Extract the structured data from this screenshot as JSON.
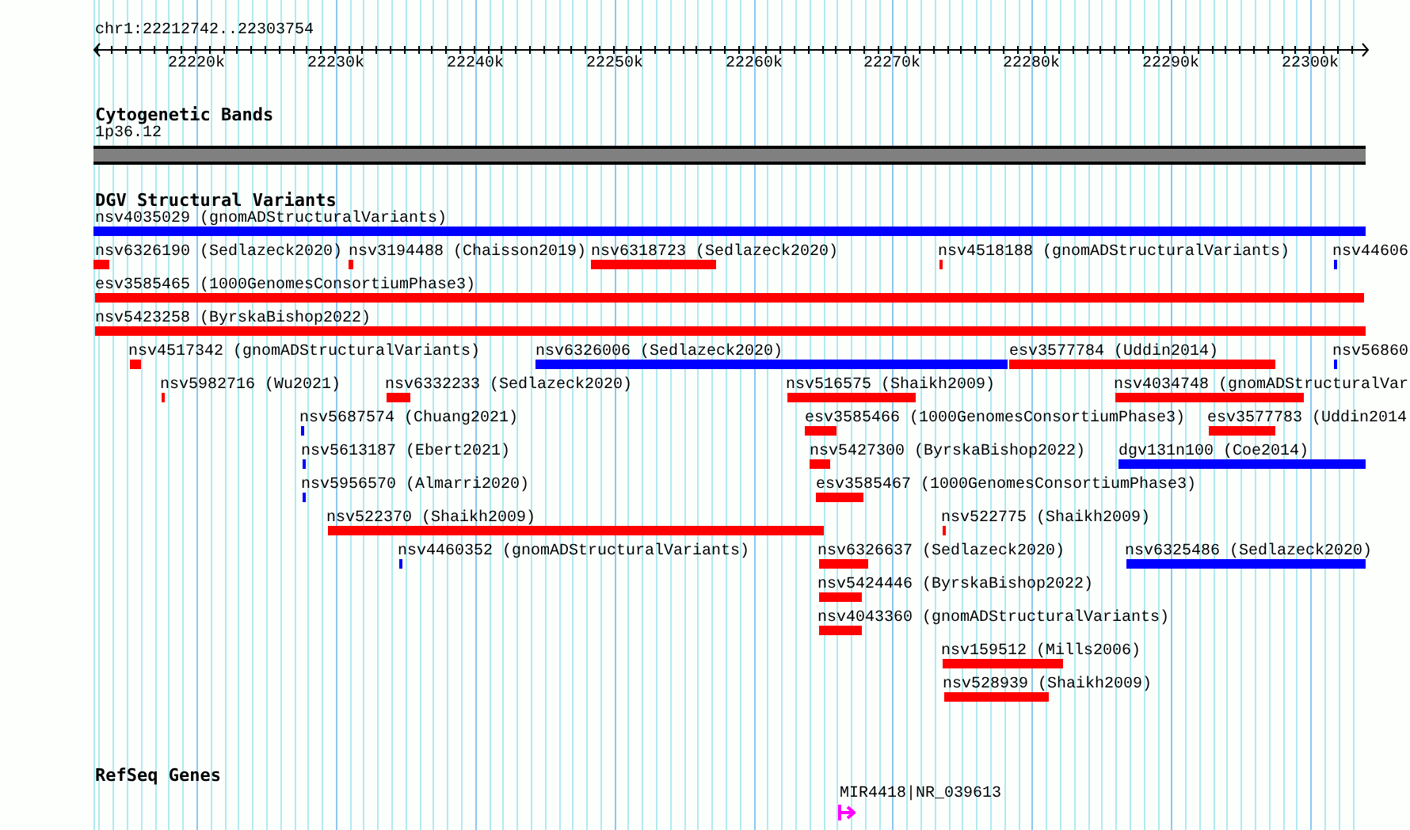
{
  "ruler": {
    "location": "chr1:22212742..22303754",
    "tick_labels": [
      "22220k",
      "22230k",
      "22240k",
      "22250k",
      "22260k",
      "22270k",
      "22280k",
      "22290k",
      "22300k"
    ]
  },
  "tracks": [
    {
      "kind": "cytoband",
      "title": "Cytogenetic Bands",
      "band": "1p36.12"
    },
    {
      "kind": "variants",
      "title": "DGV Structural Variants",
      "features": [
        {
          "label": "nsv4035029 (gnomADStructuralVariants)",
          "color": "#0000ff"
        },
        {
          "label": "nsv6326190 (Sedlazeck2020)",
          "color": "#ff0000"
        },
        {
          "label": "nsv3194488 (Chaisson2019)",
          "color": "#ff0000"
        },
        {
          "label": "nsv6318723 (Sedlazeck2020)",
          "color": "#ff0000"
        },
        {
          "label": "nsv4518188 (gnomADStructuralVariants)",
          "color": "#ff0000"
        },
        {
          "label": "nsv44606",
          "color": "#0000ff"
        },
        {
          "label": "esv3585465 (1000GenomesConsortiumPhase3)",
          "color": "#ff0000"
        },
        {
          "label": "nsv5423258 (ByrskaBishop2022)",
          "color": "#ff0000"
        },
        {
          "label": "nsv4517342 (gnomADStructuralVariants)",
          "color": "#ff0000"
        },
        {
          "label": "nsv6326006 (Sedlazeck2020)",
          "color": "#0000ff"
        },
        {
          "label": "esv3577784 (Uddin2014)",
          "color": "#ff0000"
        },
        {
          "label": "nsv56860",
          "color": "#0000ff"
        },
        {
          "label": "nsv5982716 (Wu2021)",
          "color": "#ff0000"
        },
        {
          "label": "nsv6332233 (Sedlazeck2020)",
          "color": "#ff0000"
        },
        {
          "label": "nsv516575 (Shaikh2009)",
          "color": "#ff0000"
        },
        {
          "label": "nsv4034748 (gnomADStructuralVar",
          "color": "#ff0000"
        },
        {
          "label": "nsv5687574 (Chuang2021)",
          "color": "#0000ff"
        },
        {
          "label": "esv3585466 (1000GenomesConsortiumPhase3)",
          "color": "#ff0000"
        },
        {
          "label": "esv3577783 (Uddin2014",
          "color": "#ff0000"
        },
        {
          "label": "nsv5613187 (Ebert2021)",
          "color": "#0000ff"
        },
        {
          "label": "nsv5427300 (ByrskaBishop2022)",
          "color": "#ff0000"
        },
        {
          "label": "dgv131n100 (Coe2014)",
          "color": "#0000ff"
        },
        {
          "label": "nsv5956570 (Almarri2020)",
          "color": "#0000ff"
        },
        {
          "label": "esv3585467 (1000GenomesConsortiumPhase3)",
          "color": "#ff0000"
        },
        {
          "label": "nsv522370 (Shaikh2009)",
          "color": "#ff0000"
        },
        {
          "label": "nsv522775 (Shaikh2009)",
          "color": "#ff0000"
        },
        {
          "label": "nsv4460352 (gnomADStructuralVariants)",
          "color": "#0000ff"
        },
        {
          "label": "nsv6326637 (Sedlazeck2020)",
          "color": "#ff0000"
        },
        {
          "label": "nsv6325486 (Sedlazeck2020)",
          "color": "#0000ff"
        },
        {
          "label": "nsv5424446 (ByrskaBishop2022)",
          "color": "#ff0000"
        },
        {
          "label": "nsv4043360 (gnomADStructuralVariants)",
          "color": "#ff0000"
        },
        {
          "label": "nsv159512 (Mills2006)",
          "color": "#ff0000"
        },
        {
          "label": "nsv528939 (Shaikh2009)",
          "color": "#ff0000"
        }
      ]
    },
    {
      "kind": "genes",
      "title": "RefSeq Genes",
      "features": [
        {
          "label": "MIR4418|NR_039613"
        }
      ]
    }
  ]
}
